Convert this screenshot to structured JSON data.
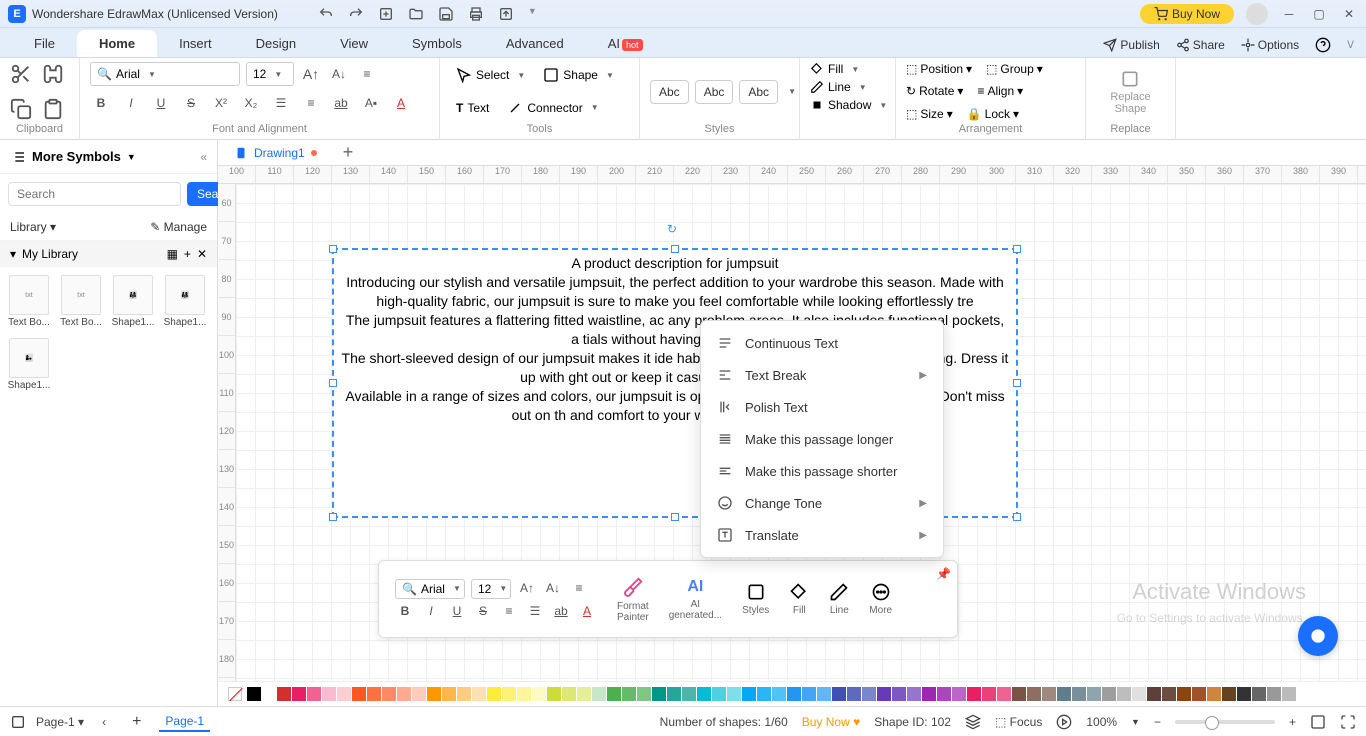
{
  "app": {
    "title": "Wondershare EdrawMax (Unlicensed Version)",
    "buyNow": "Buy Now"
  },
  "menubar": {
    "items": [
      "File",
      "Home",
      "Insert",
      "Design",
      "View",
      "Symbols",
      "Advanced"
    ],
    "ai": "AI",
    "aiTag": "hot",
    "right": {
      "publish": "Publish",
      "share": "Share",
      "options": "Options"
    }
  },
  "ribbon": {
    "clipboard": "Clipboard",
    "fontAlign": "Font and Alignment",
    "tools": "Tools",
    "styles": "Styles",
    "arrangement": "Arrangement",
    "replace": "Replace",
    "fontName": "Arial",
    "fontSize": "12",
    "select": "Select",
    "shape": "Shape",
    "text": "Text",
    "connector": "Connector",
    "abc": "Abc",
    "fill": "Fill",
    "line": "Line",
    "shadow": "Shadow",
    "position": "Position",
    "align": "Align",
    "group": "Group",
    "size": "Size",
    "rotate": "Rotate",
    "lock": "Lock",
    "replaceShape": "Replace\nShape"
  },
  "leftPanel": {
    "moreSymbols": "More Symbols",
    "searchPlaceholder": "Search",
    "searchBtn": "Search",
    "library": "Library",
    "manage": "Manage",
    "myLibrary": "My Library",
    "shapes": [
      {
        "label": "Text Bo..."
      },
      {
        "label": "Text Bo..."
      },
      {
        "label": "Shape1..."
      },
      {
        "label": "Shape1..."
      },
      {
        "label": "Shape1..."
      }
    ]
  },
  "docTabs": {
    "drawing": "Drawing1"
  },
  "rulerH": [
    "100",
    "110",
    "120",
    "130",
    "140",
    "150",
    "160",
    "170",
    "180",
    "190",
    "200",
    "210",
    "220",
    "230",
    "240",
    "250",
    "260",
    "270",
    "280",
    "290",
    "300",
    "310",
    "320",
    "330",
    "340",
    "350",
    "360",
    "370",
    "380",
    "390"
  ],
  "rulerV": [
    "60",
    "70",
    "80",
    "90",
    "100",
    "110",
    "120",
    "130",
    "140",
    "150",
    "160",
    "170",
    "180"
  ],
  "textbox": {
    "title": "A product description for jumpsuit",
    "p1": "Introducing our stylish and versatile jumpsuit, the perfect addition to your wardrobe this season. Made with high-quality fabric, our jumpsuit is sure to make you feel comfortable while looking effortlessly tre",
    "p2": "The jumpsuit features a flattering fitted waistline, ac                                                any problem areas. It also includes functional pockets, a                                              tials without having to lug aroun",
    "p3": "The short-sleeved design of our jumpsuit makes it ide                                               hable material will keep you cool all day long. Dress it up with                                               ght out or keep it casual with sandals for a",
    "p4": "Available in a range of sizes and colors, our jumpsuit is                                            opping trips to nights out with your girls. Don't miss out on th                                              and comfort to your wardrobe – get your ha"
  },
  "contextMenu": {
    "items": [
      {
        "label": "Continuous Text",
        "arrow": false
      },
      {
        "label": "Text Break",
        "arrow": true
      },
      {
        "label": "Polish Text",
        "arrow": false
      },
      {
        "label": "Make this passage longer",
        "arrow": false
      },
      {
        "label": "Make this passage shorter",
        "arrow": false
      },
      {
        "label": "Change Tone",
        "arrow": true
      },
      {
        "label": "Translate",
        "arrow": true
      }
    ]
  },
  "floatToolbar": {
    "font": "Arial",
    "size": "12",
    "formatPainter": "Format\nPainter",
    "aiGen": "AI\ngenerated...",
    "ai": "AI",
    "styles": "Styles",
    "fill": "Fill",
    "line": "Line",
    "more": "More"
  },
  "statusbar": {
    "page": "Page-1",
    "pageTab": "Page-1",
    "shapes": "Number of shapes: 1/60",
    "buyNow": "Buy Now",
    "shapeId": "Shape ID: 102",
    "focus": "Focus",
    "zoom": "100%"
  },
  "colorBar": [
    "#000",
    "#fff",
    "#d32f2f",
    "#e91e63",
    "#f06292",
    "#f8bbd0",
    "#ffcdd2",
    "#ff5722",
    "#ff7043",
    "#ff8a65",
    "#ffab91",
    "#ffccbc",
    "#ff9800",
    "#ffb74d",
    "#ffcc80",
    "#ffe0b2",
    "#ffeb3b",
    "#fff176",
    "#fff59d",
    "#fff9c4",
    "#cddc39",
    "#dce775",
    "#e6ee9c",
    "#c8e6c9",
    "#4caf50",
    "#66bb6a",
    "#81c784",
    "#009688",
    "#26a69a",
    "#4db6ac",
    "#00bcd4",
    "#4dd0e1",
    "#80deea",
    "#03a9f4",
    "#29b6f6",
    "#4fc3f7",
    "#2196f3",
    "#42a5f5",
    "#64b5f6",
    "#3f51b5",
    "#5c6bc0",
    "#7986cb",
    "#673ab7",
    "#7e57c2",
    "#9575cd",
    "#9c27b0",
    "#ab47bc",
    "#ba68c8",
    "#e91e63",
    "#ec407a",
    "#f06292",
    "#795548",
    "#8d6e63",
    "#a1887f",
    "#607d8b",
    "#78909c",
    "#90a4ae",
    "#9e9e9e",
    "#bdbdbd",
    "#e0e0e0",
    "#5d4037",
    "#6d4c41",
    "#8b4513",
    "#a0522d",
    "#cd853f",
    "#654321",
    "#333",
    "#666",
    "#999",
    "#bbb"
  ],
  "watermark": "Activate Windows",
  "watermark2": "Go to Settings to activate Windows."
}
